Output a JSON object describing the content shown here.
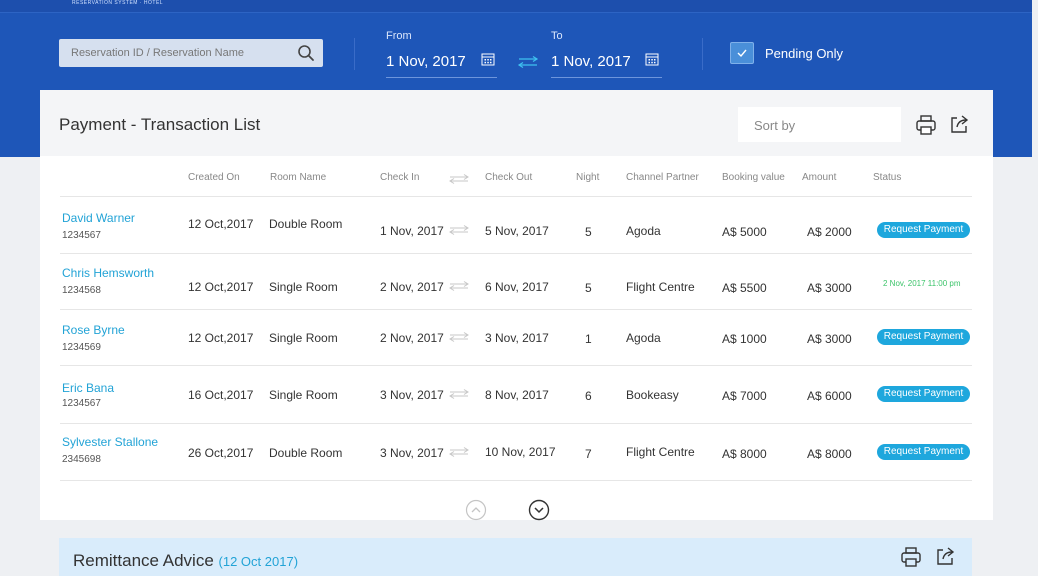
{
  "header": {
    "logo_text": "RESERVATION SYSTEM · HOTEL"
  },
  "search": {
    "placeholder": "Reservation ID / Reservation Name"
  },
  "date_range": {
    "from_label": "From",
    "from_value": "1 Nov, 2017",
    "to_label": "To",
    "to_value": "1 Nov, 2017"
  },
  "pending": {
    "label": "Pending Only",
    "checked": true
  },
  "transaction_card": {
    "title": "Payment - Transaction List",
    "sort_placeholder": "Sort by"
  },
  "table": {
    "columns": [
      "Created On",
      "Room Name",
      "Check In",
      "Check Out",
      "Night",
      "Channel Partner",
      "Booking value",
      "Amount",
      "Status"
    ],
    "rows": [
      {
        "name": "David Warner",
        "id": "1234567",
        "created": "12 Oct,2017",
        "room": "Double  Room",
        "check_in": "1 Nov, 2017",
        "check_out": "5 Nov, 2017",
        "night": "5",
        "partner": "Agoda",
        "booking": "A$ 5000",
        "amount": "A$ 2000",
        "status": "Request Payment"
      },
      {
        "name": "Chris Hemsworth",
        "id": "1234568",
        "created": "12 Oct,2017",
        "room": "Single Room",
        "check_in": "2 Nov, 2017",
        "check_out": "6 Nov, 2017",
        "night": "5",
        "partner": "Flight Centre",
        "booking": "A$ 5500",
        "amount": "A$ 3000",
        "status": "2 Nov, 2017  11:00 pm"
      },
      {
        "name": "Rose Byrne",
        "id": "1234569",
        "created": "12 Oct,2017",
        "room": "Single Room",
        "check_in": "2 Nov, 2017",
        "check_out": "3 Nov, 2017",
        "night": "1",
        "partner": "Agoda",
        "booking": "A$ 1000",
        "amount": "A$ 3000",
        "status": "Request Payment"
      },
      {
        "name": "Eric Bana",
        "id": "1234567",
        "created": "16 Oct,2017",
        "room": "Single Room",
        "check_in": "3 Nov, 2017",
        "check_out": "8 Nov, 2017",
        "night": "6",
        "partner": "Bookeasy",
        "booking": "A$ 7000",
        "amount": "A$ 6000",
        "status": "Request Payment"
      },
      {
        "name": "Sylvester Stallone",
        "id": "2345698",
        "created": "26 Oct,2017",
        "room": "Double  Room",
        "check_in": "3 Nov, 2017",
        "check_out": "10 Nov, 2017",
        "night": "7",
        "partner": "Flight Centre",
        "booking": "A$ 8000",
        "amount": "A$ 8000",
        "status": "Request Payment"
      }
    ]
  },
  "remittance": {
    "title": "Remittance Advice",
    "date": "(12 Oct 2017)"
  },
  "colors": {
    "primary_blue": "#1e56b8",
    "accent_cyan": "#1ea7dd",
    "paid_green": "#3cc46a"
  }
}
